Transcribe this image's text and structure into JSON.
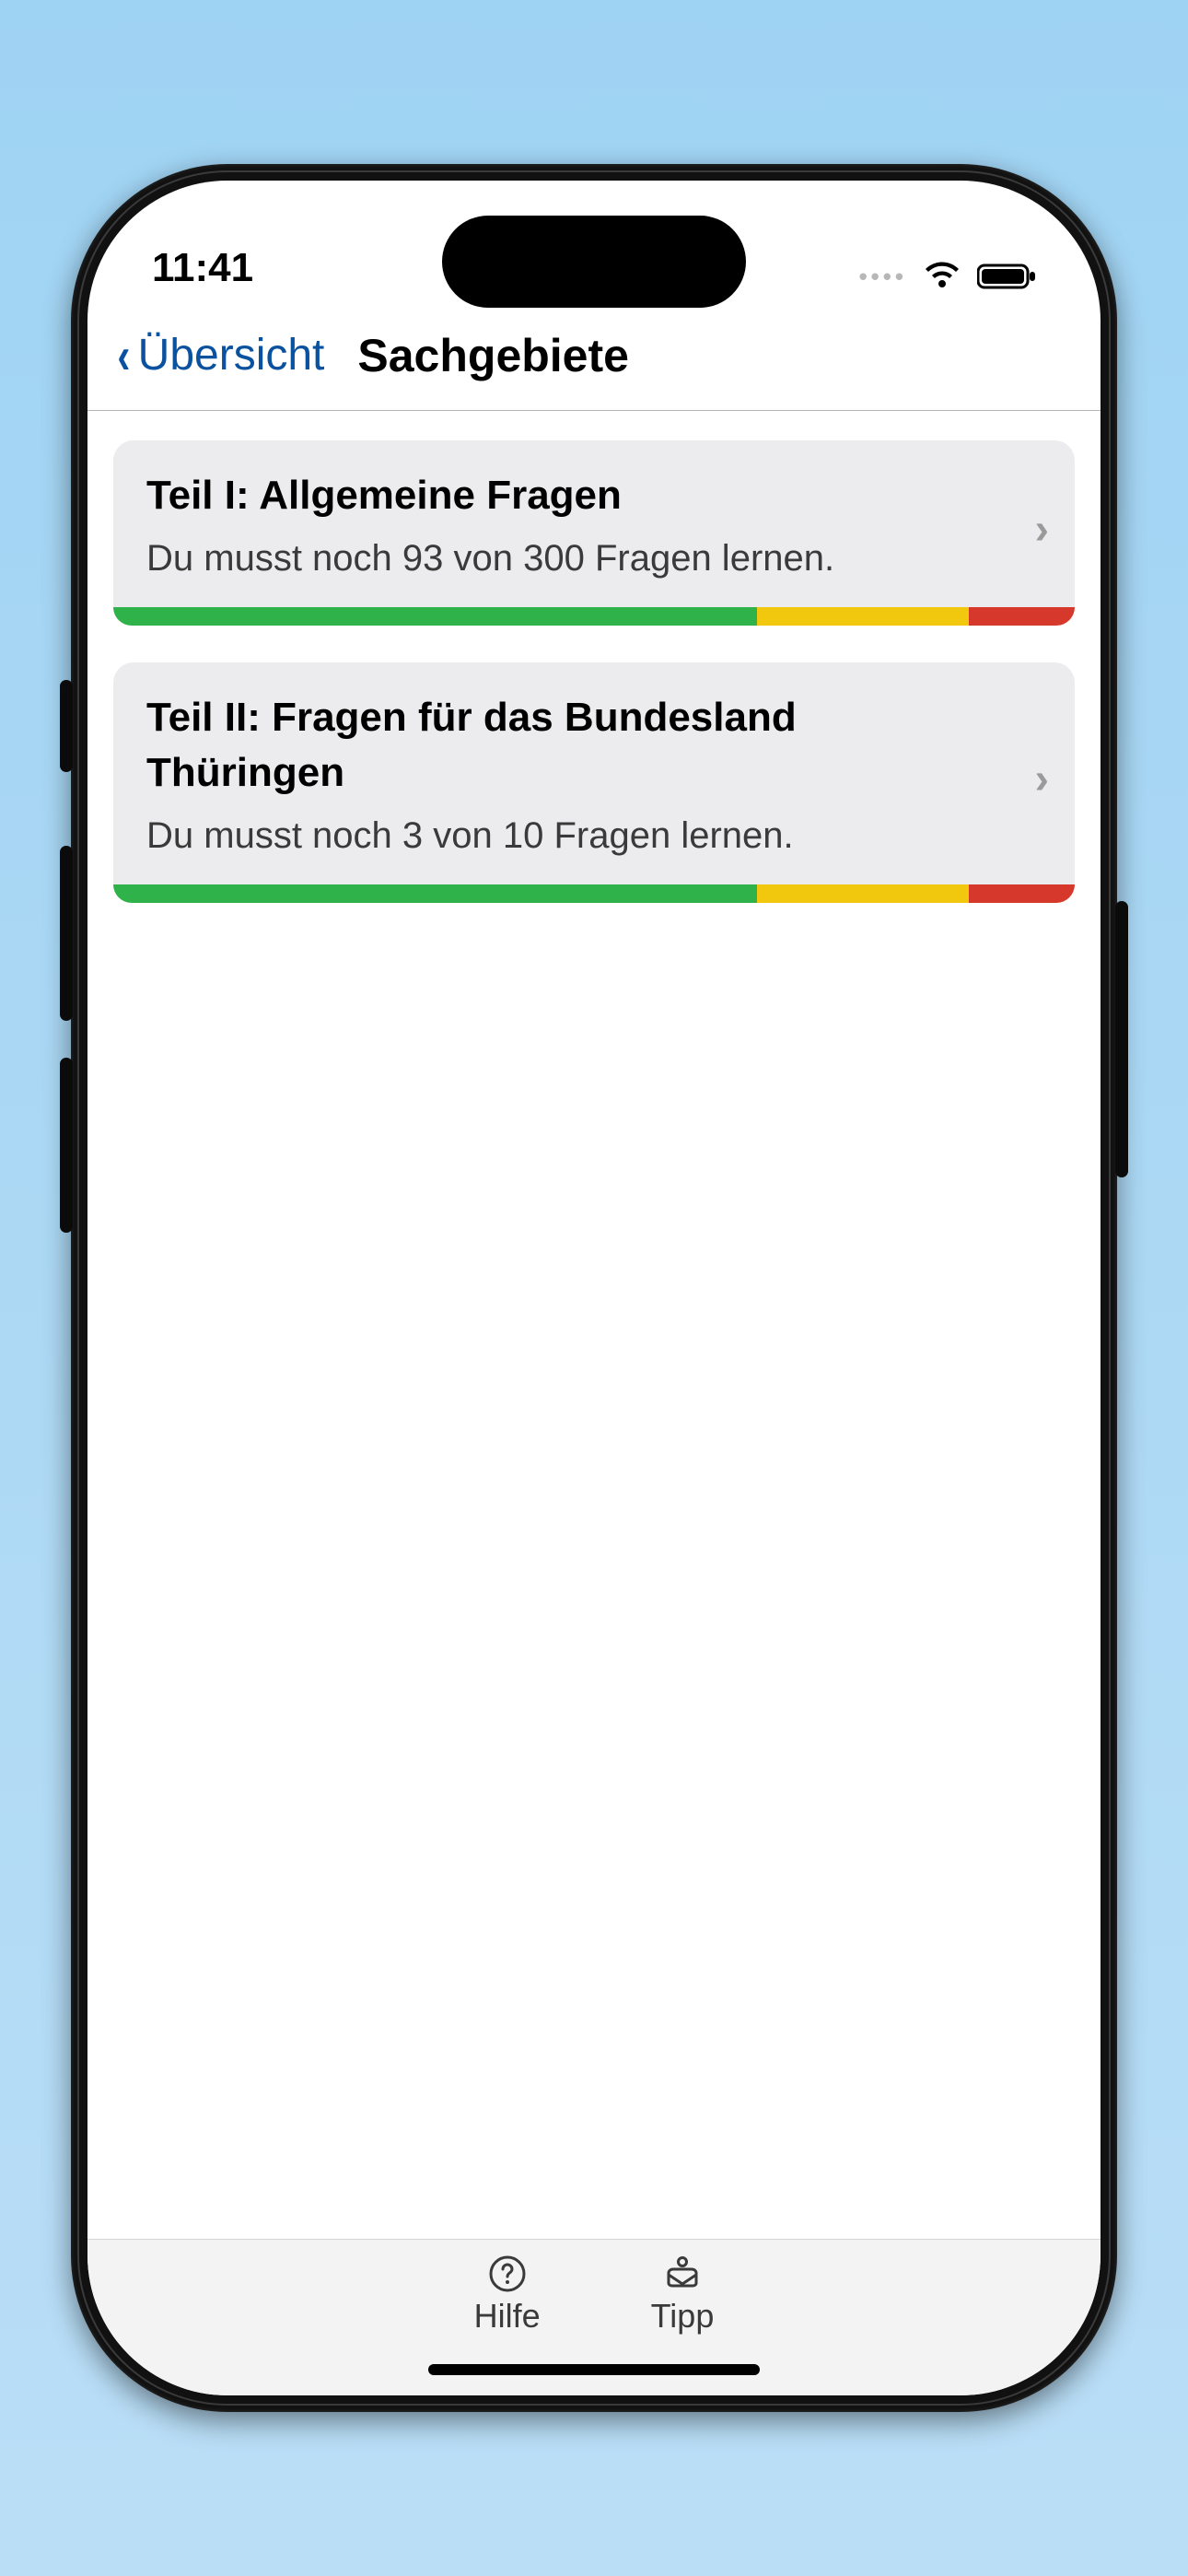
{
  "status": {
    "time": "11:41"
  },
  "nav": {
    "back_label": "Übersicht",
    "title": "Sachgebiete"
  },
  "cards": [
    {
      "title": "Teil I: Allgemeine Fragen",
      "subtitle": "Du musst noch 93 von 300 Fragen lernen.",
      "progress": {
        "green": 67,
        "yellow": 22,
        "red": 11
      }
    },
    {
      "title": "Teil II: Fragen für das Bundesland Thüringen",
      "subtitle": "Du musst noch 3 von 10 Fragen lernen.",
      "progress": {
        "green": 67,
        "yellow": 22,
        "red": 11
      }
    }
  ],
  "toolbar": {
    "help_label": "Hilfe",
    "tip_label": "Tipp"
  }
}
